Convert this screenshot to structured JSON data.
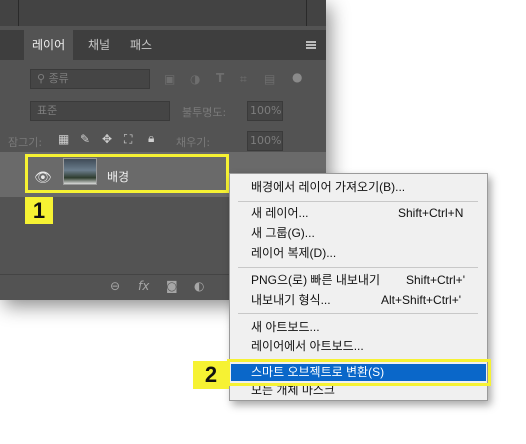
{
  "panel": {
    "tabs": [
      "레이어",
      "채널",
      "패스"
    ],
    "search_placeholder": "종류",
    "blend_mode": "표준",
    "opacity_label": "불투명도:",
    "opacity_value": "100%",
    "lock_label": "잠그기:",
    "fill_label": "채우기:",
    "fill_value": "100%",
    "layer_name": "배경",
    "bottom_icons": [
      "link-icon",
      "fx-icon",
      "mask-icon",
      "adjustment-icon"
    ],
    "bottom_fx": "fx"
  },
  "context_menu": {
    "items": [
      {
        "label": "배경에서 레이어 가져오기(B)...",
        "shortcut": ""
      },
      {
        "label": "새 레이어...",
        "shortcut": "Shift+Ctrl+N"
      },
      {
        "label": "새 그룹(G)...",
        "shortcut": ""
      },
      {
        "label": "레이어 복제(D)...",
        "shortcut": ""
      },
      {
        "label": "PNG으(로) 빠른 내보내기",
        "shortcut": "Shift+Ctrl+'"
      },
      {
        "label": "내보내기 형식...",
        "shortcut": "Alt+Shift+Ctrl+'"
      },
      {
        "label": "새 아트보드...",
        "shortcut": ""
      },
      {
        "label": "레이어에서 아트보드...",
        "shortcut": ""
      },
      {
        "label": "스마트 오브젝트로 변환(S)",
        "shortcut": ""
      },
      {
        "label": "모든 개체 마스크",
        "shortcut": ""
      }
    ],
    "selected_color": "#0a67c9"
  },
  "annotations": {
    "step1": "1",
    "step2": "2",
    "highlight_color": "#f6f233"
  }
}
